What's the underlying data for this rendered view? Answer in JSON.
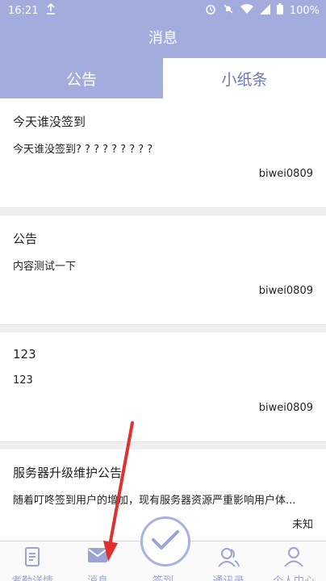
{
  "status_bar": {
    "time": "16:21",
    "battery": "100%"
  },
  "header": {
    "title": "消息"
  },
  "tabs": [
    {
      "label": "公告",
      "active": true
    },
    {
      "label": "小纸条",
      "active": false
    }
  ],
  "messages": [
    {
      "title": "今天谁没签到",
      "body": "今天谁没签到? ? ? ? ? ? ? ? ?",
      "author": "biwei0809"
    },
    {
      "title": "公告",
      "body": "内容测试一下",
      "author": "biwei0809"
    },
    {
      "title": "123",
      "body": "123",
      "author": "biwei0809"
    },
    {
      "title": "服务器升级维护公告",
      "body": "随着叮咚签到用户的增加，现有服务器资源严重影响用户体...",
      "author": "未知"
    }
  ],
  "bottom_nav": [
    {
      "label": "考勤详情",
      "icon": "document-icon"
    },
    {
      "label": "消息",
      "icon": "mail-icon"
    },
    {
      "label": "签到",
      "icon": "checkmark-icon"
    },
    {
      "label": "通讯录",
      "icon": "contacts-icon"
    },
    {
      "label": "个人中心",
      "icon": "person-icon"
    }
  ],
  "colors": {
    "primary": "#a2acdd",
    "arrow": "#e03030"
  }
}
